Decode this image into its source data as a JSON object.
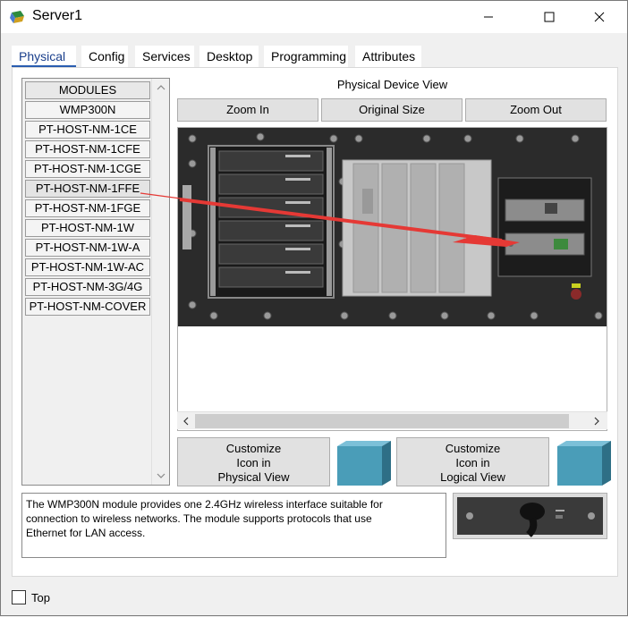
{
  "window": {
    "title": "Server1",
    "minimize_glyph": "—",
    "maximize_glyph": "☐",
    "close_glyph": "✕"
  },
  "tabs": [
    "Physical",
    "Config",
    "Services",
    "Desktop",
    "Programming",
    "Attributes"
  ],
  "active_tab": "Physical",
  "modules": {
    "header": "MODULES",
    "items": [
      "WMP300N",
      "PT-HOST-NM-1CE",
      "PT-HOST-NM-1CFE",
      "PT-HOST-NM-1CGE",
      "PT-HOST-NM-1FFE",
      "PT-HOST-NM-1FGE",
      "PT-HOST-NM-1W",
      "PT-HOST-NM-1W-A",
      "PT-HOST-NM-1W-AC",
      "PT-HOST-NM-3G/4G",
      "PT-HOST-NM-COVER"
    ],
    "selected": "PT-HOST-NM-1FFE"
  },
  "physical_view": {
    "label": "Physical Device View",
    "zoom_in": "Zoom In",
    "original_size": "Original Size",
    "zoom_out": "Zoom Out"
  },
  "customize": {
    "physical_line1": "Customize",
    "physical_line2": "Icon in",
    "physical_line3": "Physical View",
    "logical_line1": "Customize",
    "logical_line2": "Icon in",
    "logical_line3": "Logical View"
  },
  "description": "The WMP300N module provides one 2.4GHz wireless interface suitable for\nconnection to wireless networks. The module supports protocols that use\nEthernet for LAN access.",
  "top_checkbox": {
    "label": "Top",
    "checked": false
  },
  "colors": {
    "tab_underline": "#2a5db0",
    "device_chassis": "#2b2b2b",
    "cube": "#4a9db8",
    "annotation_arrow": "#e53935"
  }
}
